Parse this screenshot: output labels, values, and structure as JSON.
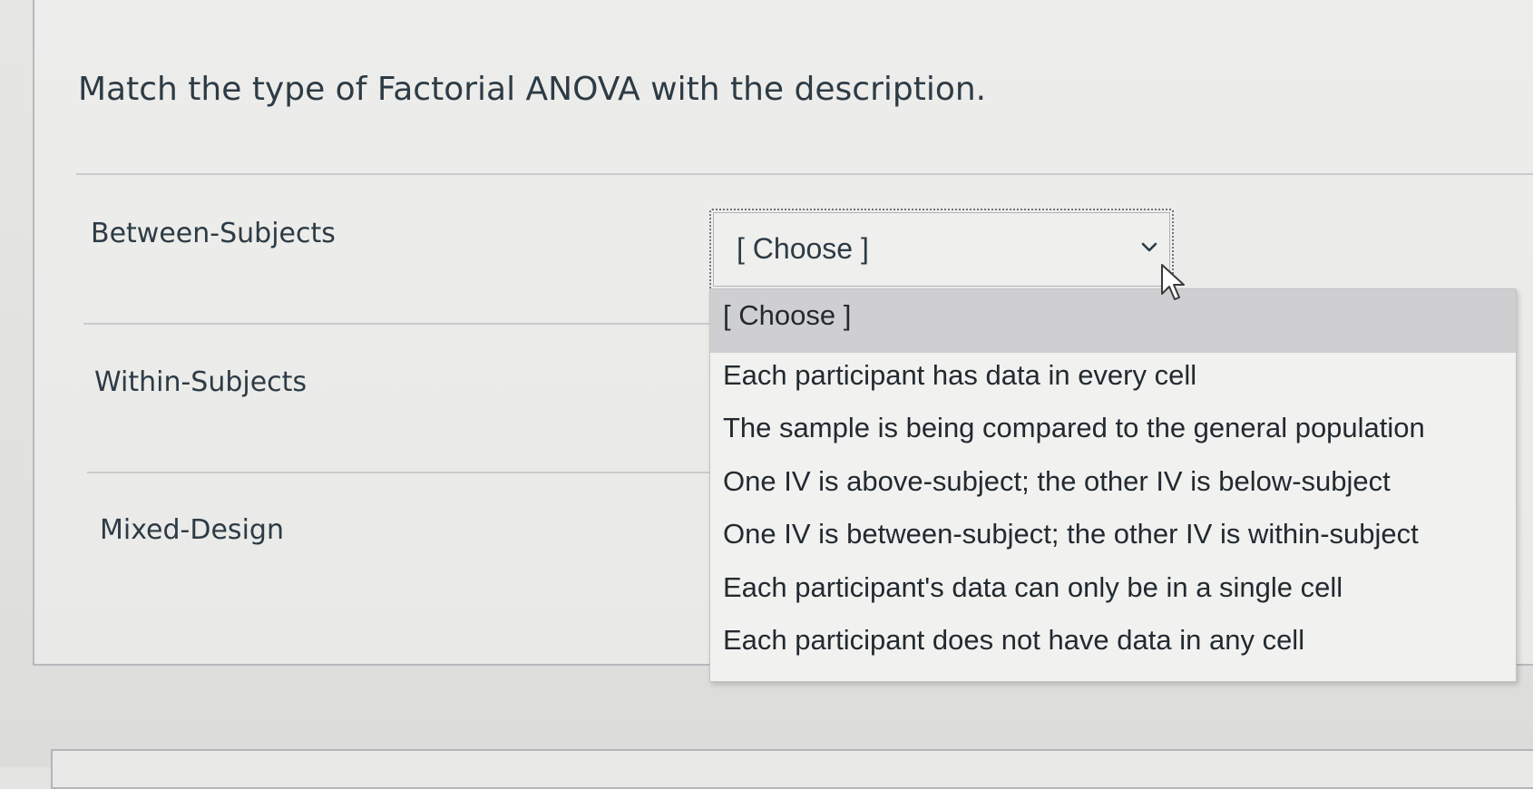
{
  "question": {
    "text": "Match the type of Factorial ANOVA with the description."
  },
  "prompts": [
    {
      "label": "Between-Subjects"
    },
    {
      "label": "Within-Subjects"
    },
    {
      "label": "Mixed-Design"
    }
  ],
  "select": {
    "value": "[ Choose ]",
    "icon": "chevron-down-icon"
  },
  "dropdown": {
    "options": [
      {
        "label": "[ Choose ]",
        "selected": true
      },
      {
        "label": "Each participant has data in every cell"
      },
      {
        "label": "The sample is being compared to the general population"
      },
      {
        "label": "One IV is above-subject; the other IV is below-subject"
      },
      {
        "label": "One IV is between-subject; the other IV is within-subject"
      },
      {
        "label": "Each participant's data can only be in a single cell"
      },
      {
        "label": "Each participant does not have data in any cell"
      }
    ]
  },
  "colors": {
    "text": "#2d3b45",
    "selected_option_bg": "#cfcfd1",
    "border": "#b7b9bb"
  }
}
